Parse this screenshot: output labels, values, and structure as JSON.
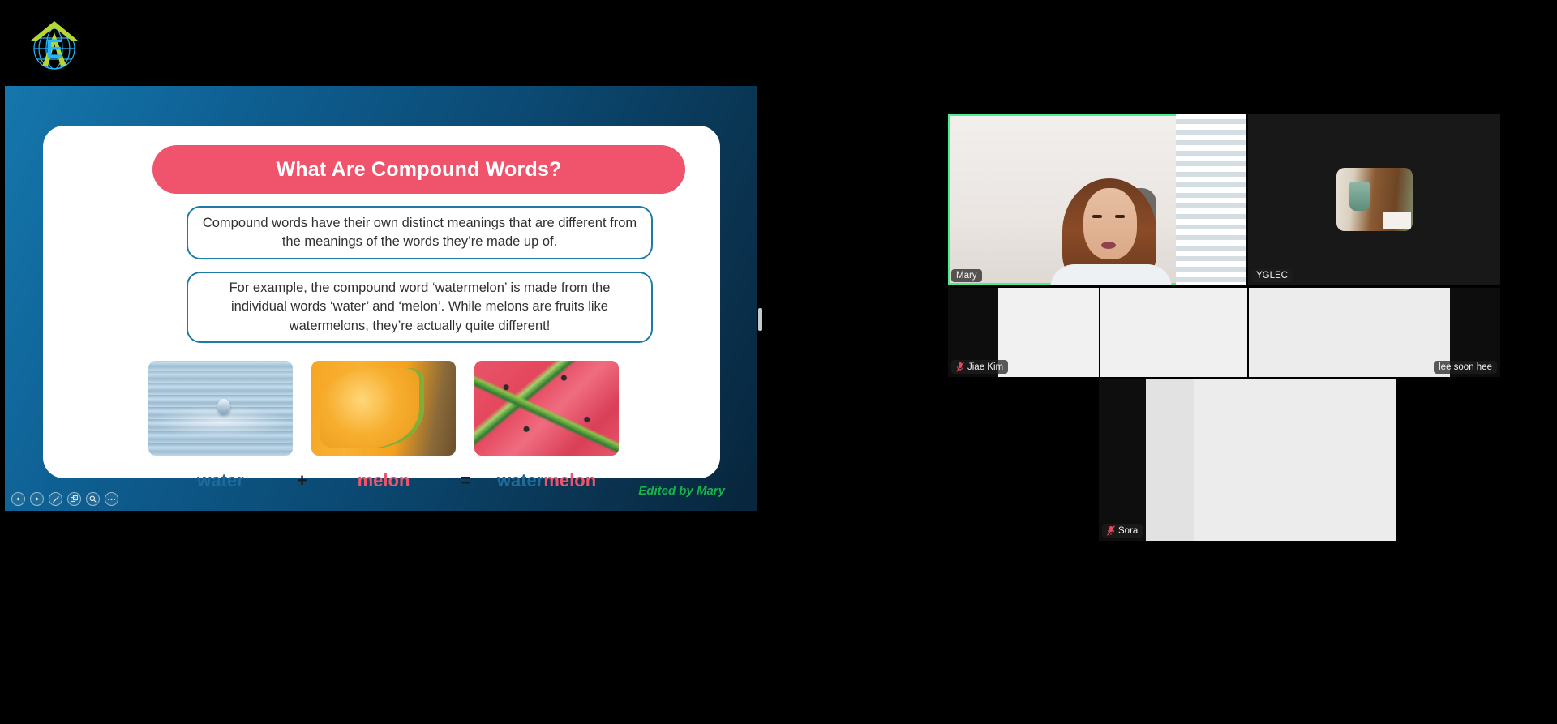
{
  "app": {
    "title": "Zoom Meeting - Screen Share",
    "background_color": "#000000",
    "accent_green": "#4cf08b"
  },
  "logo": {
    "name": "yglec-logo",
    "letter": "E",
    "globe_color": "#29b6f6",
    "arrow_color": "#b6d634"
  },
  "slide": {
    "title": "What Are Compound Words?",
    "title_pill_color": "#ef546c",
    "background_gradient": "#1577ad → #08253c",
    "card_color": "#ffffff",
    "boxes": [
      {
        "id": "definition",
        "text": "Compound words have their own distinct meanings that are different from the meanings of the words they’re made up of.",
        "border_color": "#1d7ba6"
      },
      {
        "id": "example",
        "text": "For example, the compound word ‘watermelon’ is made from the individual words ‘water’ and ‘melon’. While melons are fruits like watermelons, they’re actually quite different!",
        "border_color": "#1d7ba6"
      }
    ],
    "images": [
      {
        "name": "water-droplet-photo",
        "alt": "water"
      },
      {
        "name": "melon-slice-photo",
        "alt": "melon"
      },
      {
        "name": "watermelon-slices-photo",
        "alt": "watermelon"
      }
    ],
    "equation": {
      "term1": "water",
      "operator1": "+",
      "term2": "melon",
      "operator2": "=",
      "result_prefix": "water",
      "result_suffix": "melon",
      "blue": "#1d6a9b",
      "pink": "#ef546c"
    },
    "footer": {
      "text": "Edited by Mary",
      "color": "#17b24a"
    },
    "toolbar": [
      {
        "name": "previous-slide-button",
        "icon": "triangle-left-icon"
      },
      {
        "name": "next-slide-button",
        "icon": "triangle-right-icon"
      },
      {
        "name": "annotate-pen-button",
        "icon": "pen-icon"
      },
      {
        "name": "layout-button",
        "icon": "layout-icon"
      },
      {
        "name": "zoom-button",
        "icon": "magnifier-icon"
      },
      {
        "name": "more-options-button",
        "icon": "ellipsis-icon"
      }
    ]
  },
  "participants": [
    {
      "id": "mary",
      "name": "Mary",
      "muted": false,
      "active_speaker": true,
      "video_on": true
    },
    {
      "id": "yglec",
      "name": "YGLEC",
      "muted": false,
      "active_speaker": false,
      "video_on": false
    },
    {
      "id": "jiae",
      "name": "Jiae Kim",
      "muted": true,
      "active_speaker": false,
      "video_on": true
    },
    {
      "id": "lee",
      "name": "lee soon hee",
      "muted": false,
      "active_speaker": false,
      "video_on": true
    },
    {
      "id": "sora",
      "name": "Sora",
      "muted": true,
      "active_speaker": false,
      "video_on": true
    }
  ]
}
